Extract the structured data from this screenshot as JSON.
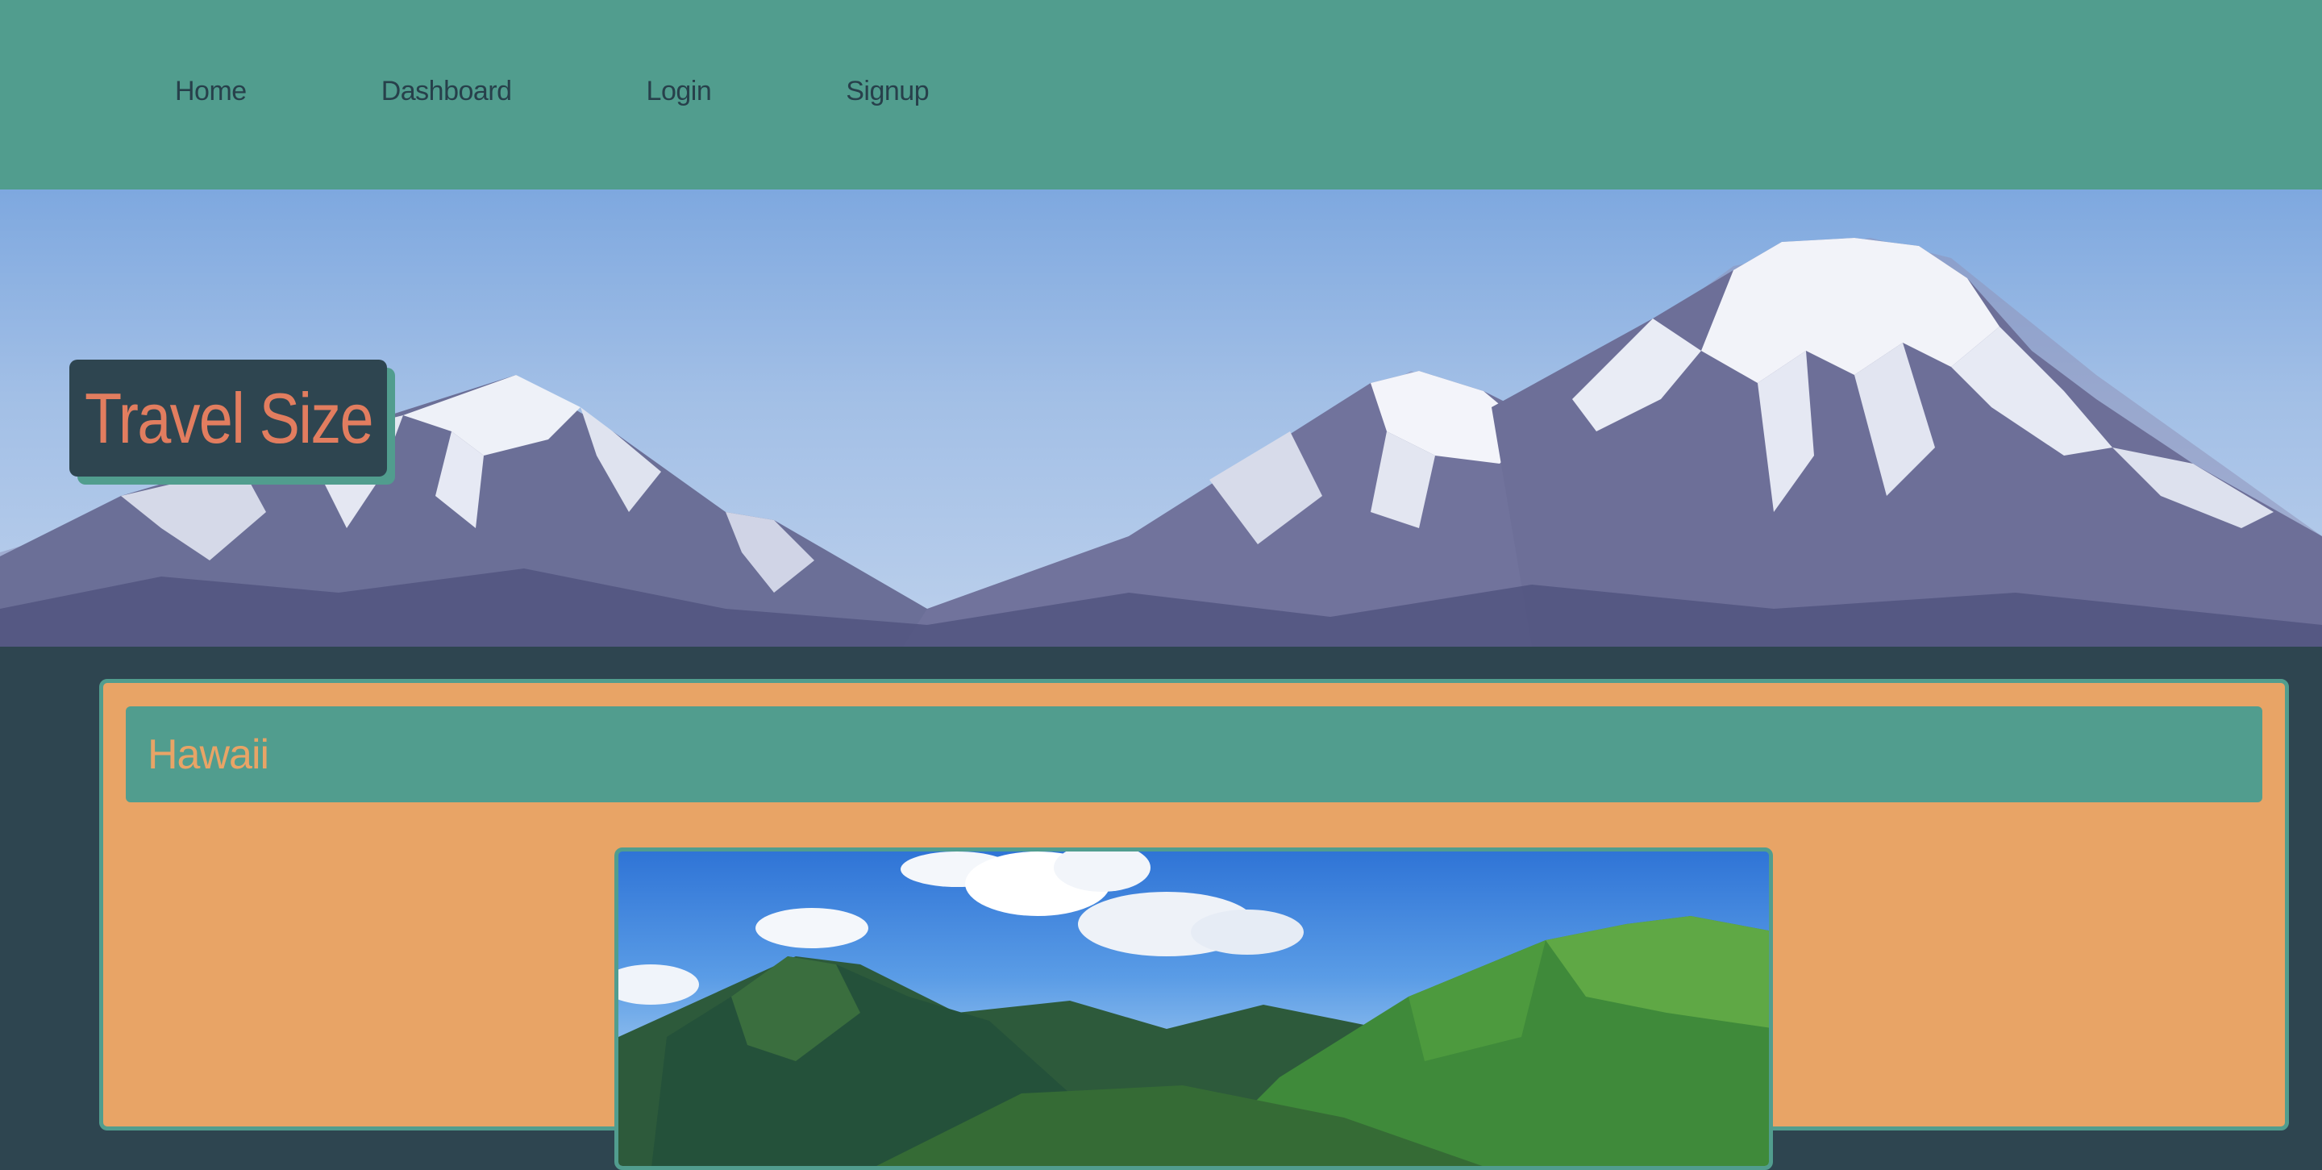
{
  "nav": {
    "items": [
      {
        "label": "Home"
      },
      {
        "label": "Dashboard"
      },
      {
        "label": "Login"
      },
      {
        "label": "Signup"
      }
    ]
  },
  "hero": {
    "brand": "Travel Size",
    "image": "mountain-range-image"
  },
  "destination": {
    "title": "Hawaii",
    "image": "hawaii-valley-image"
  },
  "colors": {
    "teal": "#519d8e",
    "dark_slate": "#2e4550",
    "sand": "#e8a466",
    "coral": "#e27d5f"
  }
}
